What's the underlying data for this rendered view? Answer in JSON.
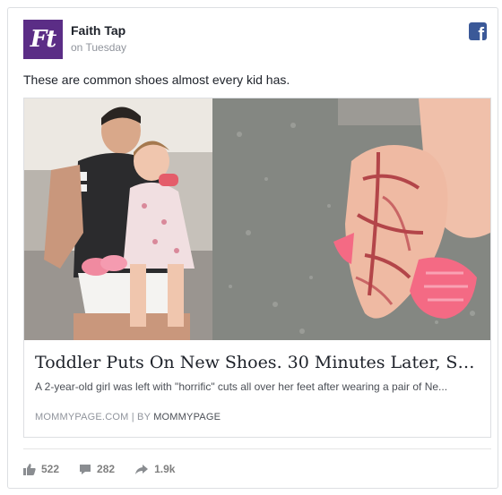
{
  "post": {
    "avatar_text": "Ft",
    "page_name": "Faith Tap",
    "time": "on Tuesday",
    "network_icon": "facebook-icon",
    "text": "These are common shoes almost every kid has."
  },
  "link": {
    "title": "Toddler Puts On New Shoes. 30 Minutes Later, She's ...",
    "description": "A 2-year-old girl was left with \"horrific\" cuts all over her feet after wearing a pair of Ne...",
    "source_domain": "MOMMYPAGE.COM",
    "source_separator": "| BY",
    "source_author": "MOMMYPAGE",
    "image_description": "Left: father holding toddler with pink shoes; right: toddler's foot with red cuts beside pink jelly shoe"
  },
  "stats": {
    "likes": "522",
    "comments": "282",
    "shares": "1.9k"
  },
  "colors": {
    "brand_purple": "#5b2d86",
    "facebook_blue": "#3b5998",
    "muted_text": "#90949c"
  }
}
